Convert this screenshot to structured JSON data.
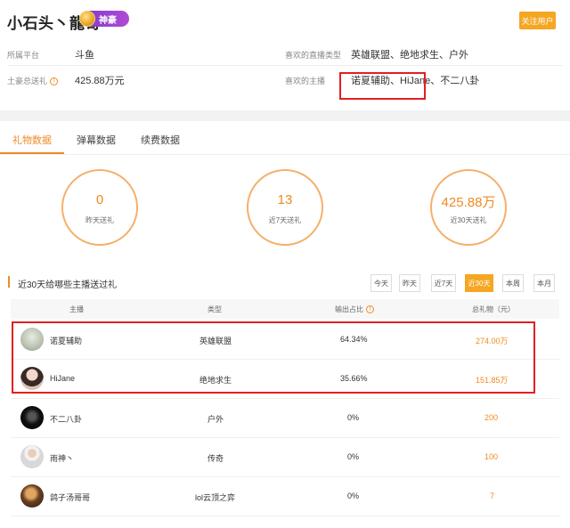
{
  "profile": {
    "name": "小石头丶龍哥",
    "badge": "神豪",
    "follow_label": "关注用户",
    "platform_label": "所属平台",
    "platform_value": "斗鱼",
    "fav_type_label": "喜欢的直播类型",
    "fav_type_value": "英雄联盟、绝地求生、户外",
    "total_label": "土豪总送礼",
    "total_value": "425.88万元",
    "fav_anchor_label": "喜欢的主播",
    "fav_anchor_value": "诺夏辅助、HiJane、不二八卦"
  },
  "tabs": [
    "礼物数据",
    "弹幕数据",
    "续费数据"
  ],
  "stats": [
    {
      "value": "0",
      "caption": "昨天送礼"
    },
    {
      "value": "13",
      "caption": "近7天送礼"
    },
    {
      "value": "425.88万",
      "caption": "近30天送礼"
    }
  ],
  "section_title": "近30天给哪些主播送过礼",
  "ranges": [
    "今天",
    "昨天",
    "近7天",
    "近30天",
    "本周",
    "本月"
  ],
  "table": {
    "headers": [
      "主播",
      "类型",
      "输出占比",
      "总礼物（元）"
    ],
    "rows": [
      {
        "anchor": "诺夏辅助",
        "type": "英雄联盟",
        "ratio": "64.34%",
        "total": "274.00万"
      },
      {
        "anchor": "HiJane",
        "type": "绝地求生",
        "ratio": "35.66%",
        "total": "151.85万"
      },
      {
        "anchor": "不二八卦",
        "type": "户外",
        "ratio": "0%",
        "total": "200"
      },
      {
        "anchor": "雨神丶",
        "type": "传奇",
        "ratio": "0%",
        "total": "100"
      },
      {
        "anchor": "鸽子汤哥哥",
        "type": "lol云顶之弈",
        "ratio": "0%",
        "total": "7"
      }
    ]
  },
  "colors": {
    "accent": "#f08a24",
    "highlight": "#e02020"
  }
}
